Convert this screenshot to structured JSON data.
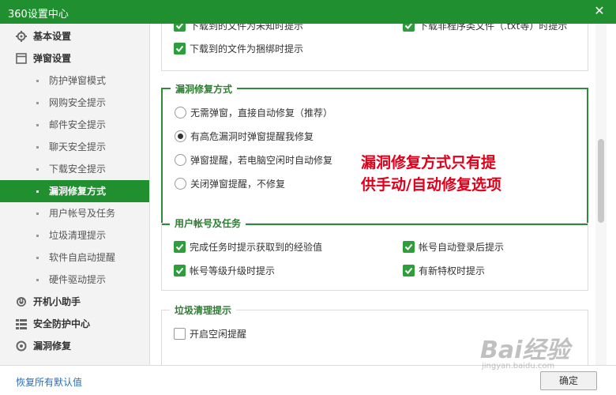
{
  "window": {
    "title": "360设置中心",
    "close_glyph": "✕"
  },
  "sidebar": {
    "categories": [
      {
        "label": "基本设置",
        "icon": "gear-icon"
      },
      {
        "label": "弹窗设置",
        "icon": "window-icon"
      },
      {
        "label": "开机小助手",
        "icon": "power-icon"
      },
      {
        "label": "安全防护中心",
        "icon": "shield-list-icon"
      },
      {
        "label": "漏洞修复",
        "icon": "repair-icon"
      }
    ],
    "subitems": [
      "防护弹窗模式",
      "网购安全提示",
      "邮件安全提示",
      "聊天安全提示",
      "下载安全提示",
      "漏洞修复方式",
      "用户帐号及任务",
      "垃圾清理提示",
      "软件自启动提醒",
      "硬件驱动提示"
    ],
    "active_subitem": "漏洞修复方式"
  },
  "download_section": {
    "options": [
      {
        "label": "下载到的文件为未知时提示",
        "checked": true
      },
      {
        "label": "下载非程序类文件（.txt等）时提示",
        "checked": true
      },
      {
        "label": "下载到的文件为捆绑时提示",
        "checked": true
      }
    ]
  },
  "vuln_section": {
    "title": "漏洞修复方式",
    "options": [
      {
        "label": "无需弹窗，直接自动修复（推荐）",
        "selected": false
      },
      {
        "label": "有高危漏洞时弹窗提醒我修复",
        "selected": true
      },
      {
        "label": "弹窗提醒，若电脑空闲时自动修复",
        "selected": false
      },
      {
        "label": "关闭弹窗提醒，不修复",
        "selected": false
      }
    ]
  },
  "annotation": {
    "line1": "漏洞修复方式只有提",
    "line2": "供手动/自动修复选项",
    "color": "#e0001b"
  },
  "account_section": {
    "title": "用户帐号及任务",
    "options": [
      {
        "label": "完成任务时提示获取到的经验值",
        "checked": true
      },
      {
        "label": "帐号自动登录后提示",
        "checked": true
      },
      {
        "label": "帐号等级升级时提示",
        "checked": true
      },
      {
        "label": "有新特权时提示",
        "checked": true
      }
    ]
  },
  "cleanup_section": {
    "title": "垃圾清理提示",
    "options": [
      {
        "label": "开启空闲提醒",
        "checked": false
      }
    ]
  },
  "footer": {
    "restore_label": "恢复所有默认值",
    "ok_label": "确定"
  },
  "watermark": {
    "text": "Bai经验",
    "url": "jingyan.baidu.com"
  },
  "colors": {
    "brand_green": "#1f8f2f",
    "check_green": "#2e9e3c",
    "link_blue": "#2a6db5"
  }
}
